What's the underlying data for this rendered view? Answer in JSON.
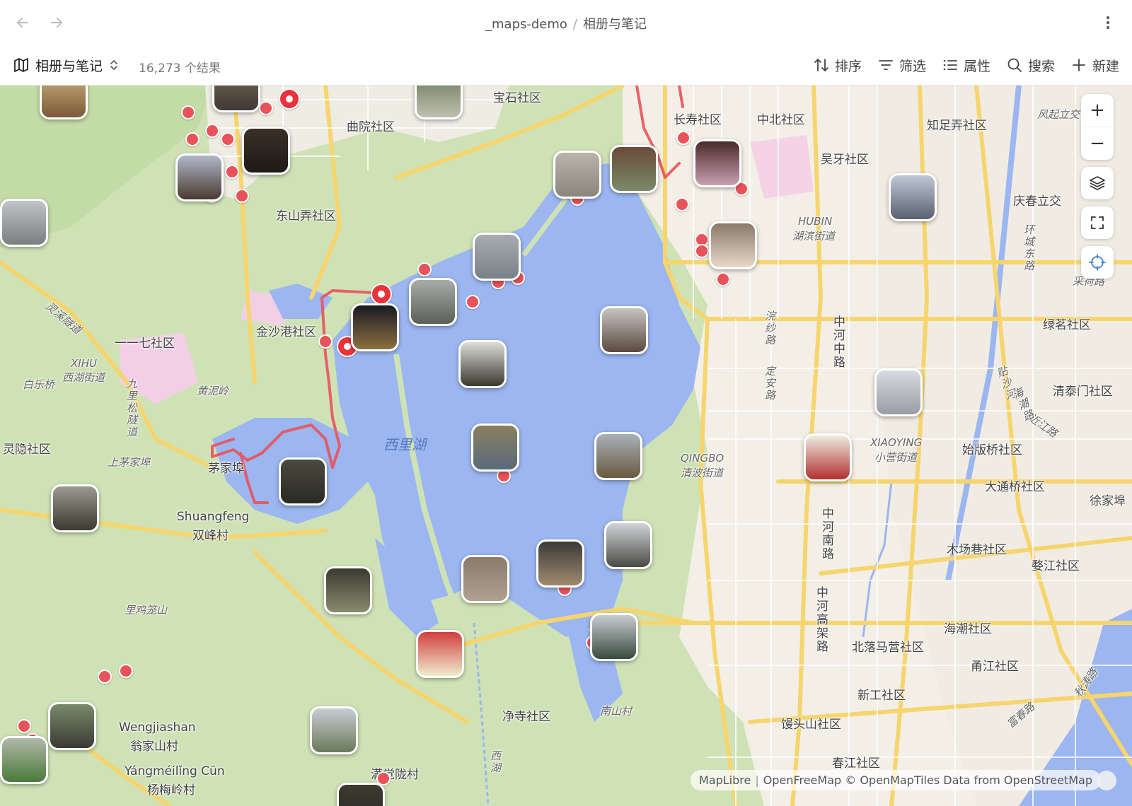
{
  "header": {
    "back_icon": "arrow-left-icon",
    "forward_icon": "arrow-right-icon",
    "breadcrumb": [
      "_maps-demo",
      "相册与笔记"
    ],
    "separator": "/",
    "more_icon": "more-vertical-icon"
  },
  "toolbar": {
    "view_name": "相册与笔记",
    "view_icon": "map-icon",
    "result_count": "16,273 个结果",
    "actions": [
      {
        "label": "排序",
        "icon": "sort-icon"
      },
      {
        "label": "筛选",
        "icon": "filter-icon"
      },
      {
        "label": "属性",
        "icon": "list-icon"
      },
      {
        "label": "搜索",
        "icon": "search-icon"
      },
      {
        "label": "新建",
        "icon": "plus-icon"
      }
    ]
  },
  "map": {
    "controls": {
      "zoom_in": "+",
      "zoom_out": "−",
      "layers_icon": "layers-icon",
      "fullscreen_icon": "fullscreen-icon",
      "locate_icon": "locate-icon"
    },
    "labels": [
      "宝石社区",
      "长寿社区",
      "中北社区",
      "知足弄社区",
      "曲院社区",
      "吴牙社区",
      "东山弄社区",
      "庆春立交",
      "HUBIN",
      "湖滨街道",
      "金沙港社区",
      "一一七社区",
      "XIHU",
      "西湖街道",
      "白乐桥",
      "灵溪隧道",
      "黄泥岭",
      "九里松隧道",
      "灵隐社区",
      "上茅家埠",
      "茅家埠",
      "西里湖",
      "Shuangfeng",
      "双峰村",
      "浣纱路",
      "中河中路",
      "定安路",
      "QINGBO",
      "清波街道",
      "XIAOYING",
      "小营街道",
      "清泰门社区",
      "近江路",
      "始版桥社区",
      "大通桥社区",
      "徐家埠",
      "木场巷社区",
      "婺江社区",
      "中河南路",
      "中河高架路",
      "北落马营社区",
      "海潮社区",
      "甬江社区",
      "新工社区",
      "里鸡笼山",
      "净寺社区",
      "南山村",
      "馒头山社区",
      "Wengjiashan",
      "翁家山村",
      "Yángméilǐng Cūn",
      "杨梅岭村",
      "满觉陇村",
      "西湖",
      "春江社区",
      "绿茗社区",
      "环城东路",
      "采荷路",
      "风起立交",
      "贴沙河",
      "海潮路",
      "秋涛路",
      "富春路"
    ],
    "attribution": [
      "MapLibre",
      "OpenFreeMap © OpenMapTiles Data from OpenStreetMap"
    ],
    "colors": {
      "lake": "#9bb6f0",
      "park": "#c8deb0",
      "urban": "#f3efe6",
      "road_major": "#f6d56e",
      "track": "#e8535a",
      "pin": "#e8535a"
    }
  }
}
